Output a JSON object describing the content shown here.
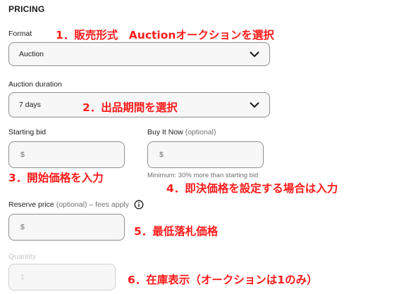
{
  "section_title": "PRICING",
  "format": {
    "label": "Format",
    "value": "Auction"
  },
  "duration": {
    "label": "Auction duration",
    "value": "7 days"
  },
  "starting_bid": {
    "label": "Starting bid",
    "placeholder": "$"
  },
  "buy_it_now": {
    "label": "Buy It Now",
    "optional": "(optional)",
    "placeholder": "$",
    "helper": "Minimum: 30% more than starting bid"
  },
  "reserve_price": {
    "label": "Reserve price",
    "optional": "(optional) – fees apply",
    "placeholder": "$"
  },
  "quantity": {
    "label": "Quantity",
    "value": "1"
  },
  "annotations": {
    "a1": "1．販売形式　Auctionオークションを選択",
    "a2": "2．出品期間を選択",
    "a3": "3．開始価格を入力",
    "a4": "4．即決価格を設定する場合は入力",
    "a5": "5．最低落札価格",
    "a6": "6．在庫表示（オークションは1のみ）"
  },
  "colors": {
    "annotation": "#ff1a1a",
    "border": "#8f8f8f",
    "field_bg": "#f7f7f7"
  },
  "icons": {
    "dropdown": "chevron-down-icon",
    "info": "info-icon"
  }
}
